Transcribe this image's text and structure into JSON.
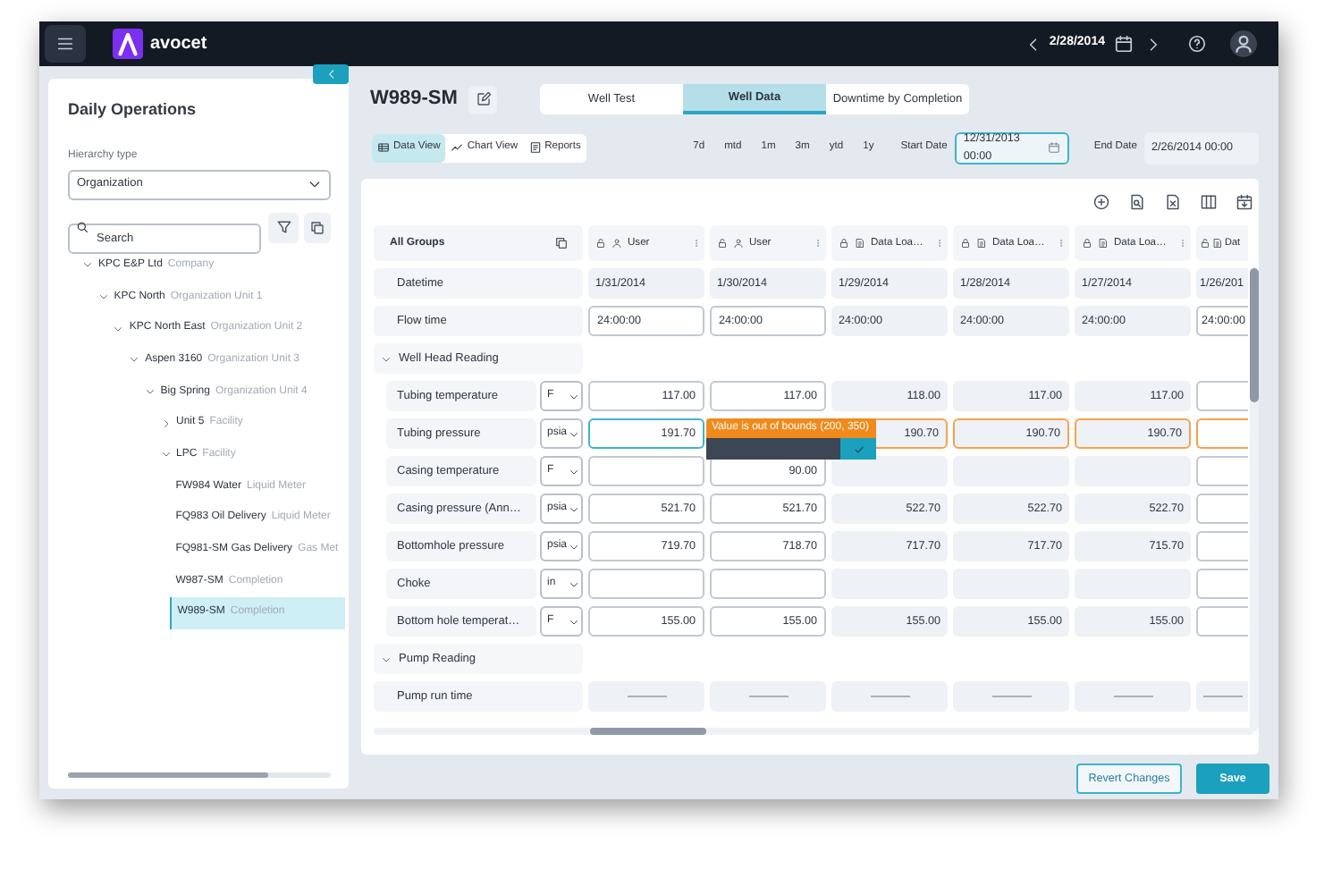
{
  "top_bar": {
    "app_name": "avocet",
    "date": "2/28/2014"
  },
  "sidebar": {
    "title": "Daily Operations",
    "hierarchy_label": "Hierarchy type",
    "hierarchy_value": "Organization",
    "search_placeholder": "Search",
    "tree": [
      {
        "name": "KPC E&P Ltd",
        "type": "Company",
        "expanded": true,
        "selected": false,
        "children": [
          {
            "name": "KPC North",
            "type": "Organization Unit 1",
            "expanded": true,
            "selected": false,
            "children": [
              {
                "name": "KPC North East",
                "type": "Organization Unit 2",
                "expanded": true,
                "selected": false,
                "children": [
                  {
                    "name": "Aspen 3160",
                    "type": "Organization Unit 3",
                    "expanded": true,
                    "selected": false,
                    "children": [
                      {
                        "name": "Big Spring",
                        "type": "Organization Unit 4",
                        "expanded": true,
                        "selected": false,
                        "children": [
                          {
                            "name": "Unit 5",
                            "type": "Facility",
                            "expanded": false,
                            "selected": false
                          },
                          {
                            "name": "LPC",
                            "type": "Facility",
                            "expanded": true,
                            "selected": false,
                            "children": [
                              {
                                "name": "FW984 Water",
                                "type": "Liquid Meter",
                                "selected": false
                              },
                              {
                                "name": "FQ983 Oil Delivery",
                                "type": "Liquid Meter",
                                "selected": false
                              },
                              {
                                "name": "FQ981-SM Gas Delivery",
                                "type": "Gas Met",
                                "selected": false
                              },
                              {
                                "name": "W987-SM",
                                "type": "Completion",
                                "selected": false
                              },
                              {
                                "name": "W989-SM",
                                "type": "Completion",
                                "selected": true
                              }
                            ]
                          }
                        ]
                      }
                    ]
                  }
                ]
              }
            ]
          }
        ]
      }
    ]
  },
  "main": {
    "title": "W989-SM",
    "tabs": [
      {
        "label": "Well Test",
        "selected": false
      },
      {
        "label": "Well Data",
        "selected": true
      },
      {
        "label": "Downtime by Completion",
        "selected": false
      }
    ],
    "views": [
      {
        "label": "Data View",
        "kind": "table",
        "selected": true
      },
      {
        "label": "Chart View",
        "kind": "chart",
        "selected": false
      },
      {
        "label": "Reports",
        "kind": "report",
        "selected": false
      }
    ],
    "ranges": [
      "7d",
      "mtd",
      "1m",
      "3m",
      "ytd",
      "1y"
    ],
    "start_date": {
      "label": "Start Date",
      "value": "12/31/2013 00:00"
    },
    "end_date": {
      "label": "End Date",
      "value": "2/26/2014 00:00"
    },
    "grid": {
      "groups_header": "All Groups",
      "columns": [
        {
          "locked": false,
          "kind": "user",
          "label": "User"
        },
        {
          "locked": false,
          "kind": "user",
          "label": "User"
        },
        {
          "locked": true,
          "kind": "data",
          "label": "Data Loa…"
        },
        {
          "locked": true,
          "kind": "data",
          "label": "Data Loa…"
        },
        {
          "locked": true,
          "kind": "data",
          "label": "Data Loa…"
        },
        {
          "locked": false,
          "kind": "data",
          "label": "Dat"
        }
      ],
      "rows": [
        {
          "kind": "time",
          "label": "Datetime",
          "cells": [
            {
              "kind": "readonly",
              "value": "1/31/2014"
            },
            {
              "kind": "readonly",
              "value": "1/30/2014"
            },
            {
              "kind": "readonly",
              "value": "1/29/2014"
            },
            {
              "kind": "readonly",
              "value": "1/28/2014"
            },
            {
              "kind": "readonly",
              "value": "1/27/2014"
            },
            {
              "kind": "readonly",
              "value": "1/26/201"
            }
          ]
        },
        {
          "kind": "time",
          "label": "Flow time",
          "cells": [
            {
              "kind": "input",
              "value": "24:00:00"
            },
            {
              "kind": "input",
              "value": "24:00:00"
            },
            {
              "kind": "readonly",
              "value": "24:00:00"
            },
            {
              "kind": "readonly",
              "value": "24:00:00"
            },
            {
              "kind": "readonly",
              "value": "24:00:00"
            },
            {
              "kind": "input",
              "value": "24:00:00"
            }
          ]
        },
        {
          "kind": "group",
          "label": "Well Head Reading",
          "expanded": true
        },
        {
          "kind": "measure",
          "label": "Tubing temperature",
          "unit": "F",
          "cells": [
            {
              "kind": "input",
              "value": "117.00"
            },
            {
              "kind": "input",
              "value": "117.00"
            },
            {
              "kind": "readonly",
              "value": "118.00"
            },
            {
              "kind": "readonly",
              "value": "117.00"
            },
            {
              "kind": "readonly",
              "value": "117.00"
            },
            {
              "kind": "input"
            }
          ]
        },
        {
          "kind": "measure",
          "label": "Tubing pressure",
          "unit": "psia",
          "cells": [
            {
              "kind": "input",
              "value": "191.70",
              "focused": true,
              "popup": "Value is out of bounds (200, 350)"
            },
            null,
            {
              "kind": "readonly",
              "value": "190.70",
              "out_of_bounds": true
            },
            {
              "kind": "readonly",
              "value": "190.70",
              "out_of_bounds": true
            },
            {
              "kind": "readonly",
              "value": "190.70",
              "out_of_bounds": true
            },
            {
              "kind": "input",
              "out_of_bounds": true
            }
          ]
        },
        {
          "kind": "measure",
          "label": "Casing temperature",
          "unit": "F",
          "cells": [
            {
              "kind": "input"
            },
            {
              "kind": "input",
              "value": "90.00"
            },
            {
              "kind": "readonly"
            },
            {
              "kind": "readonly"
            },
            {
              "kind": "readonly"
            },
            {
              "kind": "input"
            }
          ]
        },
        {
          "kind": "measure",
          "label": "Casing pressure (Ann…",
          "unit": "psia",
          "cells": [
            {
              "kind": "input",
              "value": "521.70"
            },
            {
              "kind": "input",
              "value": "521.70"
            },
            {
              "kind": "readonly",
              "value": "522.70"
            },
            {
              "kind": "readonly",
              "value": "522.70"
            },
            {
              "kind": "readonly",
              "value": "522.70"
            },
            {
              "kind": "input"
            }
          ]
        },
        {
          "kind": "measure",
          "label": "Bottomhole pressure",
          "unit": "psia",
          "cells": [
            {
              "kind": "input",
              "value": "719.70"
            },
            {
              "kind": "input",
              "value": "718.70"
            },
            {
              "kind": "readonly",
              "value": "717.70"
            },
            {
              "kind": "readonly",
              "value": "717.70"
            },
            {
              "kind": "readonly",
              "value": "715.70"
            },
            {
              "kind": "input"
            }
          ]
        },
        {
          "kind": "measure",
          "label": "Choke",
          "unit": "in",
          "cells": [
            {
              "kind": "input"
            },
            {
              "kind": "input"
            },
            {
              "kind": "readonly"
            },
            {
              "kind": "readonly"
            },
            {
              "kind": "readonly"
            },
            {
              "kind": "input"
            }
          ]
        },
        {
          "kind": "measure",
          "label": "Bottom hole temperat…",
          "unit": "F",
          "cells": [
            {
              "kind": "input",
              "value": "155.00"
            },
            {
              "kind": "input",
              "value": "155.00"
            },
            {
              "kind": "readonly",
              "value": "155.00"
            },
            {
              "kind": "readonly",
              "value": "155.00"
            },
            {
              "kind": "readonly",
              "value": "155.00"
            },
            {
              "kind": "input"
            }
          ]
        },
        {
          "kind": "group",
          "label": "Pump Reading",
          "expanded": true
        },
        {
          "kind": "time",
          "label": "Pump run time",
          "cells": [
            {
              "kind": "dash"
            },
            {
              "kind": "dash"
            },
            {
              "kind": "dash"
            },
            {
              "kind": "dash"
            },
            {
              "kind": "dash"
            },
            {
              "kind": "dash"
            }
          ]
        }
      ]
    },
    "buttons": [
      {
        "label": "Revert Changes",
        "kind": "secondary"
      },
      {
        "label": "Save",
        "kind": "primary"
      }
    ]
  }
}
